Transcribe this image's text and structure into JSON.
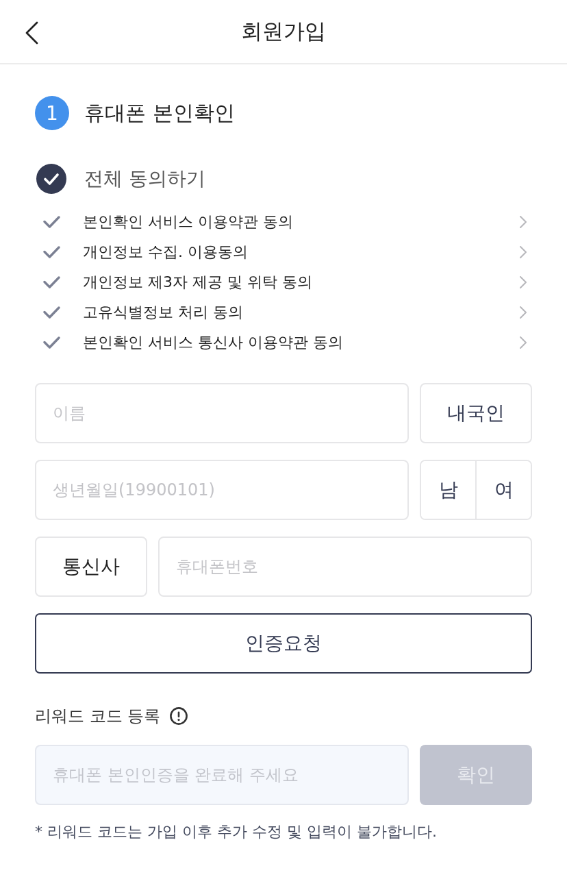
{
  "header": {
    "title": "회원가입"
  },
  "step": {
    "number": "1",
    "title": "휴대폰 본인확인"
  },
  "agree_all": {
    "label": "전체 동의하기",
    "checked": true
  },
  "terms": [
    {
      "label": "본인확인 서비스 이용약관 동의",
      "checked": true
    },
    {
      "label": "개인정보 수집. 이용동의",
      "checked": true
    },
    {
      "label": "개인정보 제3자 제공 및 위탁 동의",
      "checked": true
    },
    {
      "label": "고유식별정보 처리 동의",
      "checked": true
    },
    {
      "label": "본인확인 서비스 통신사 이용약관 동의",
      "checked": true
    }
  ],
  "form": {
    "name_field": {
      "placeholder": "이름"
    },
    "nationality_button": "내국인",
    "birth_field": {
      "placeholder": "생년월일(19900101)"
    },
    "gender": [
      {
        "label": "남",
        "selected": false
      },
      {
        "label": "여",
        "selected": false
      }
    ],
    "carrier_button": "통신사",
    "phone_field": {
      "placeholder": "휴대폰번호"
    },
    "request_button": "인증요청"
  },
  "reward": {
    "title": "리워드 코드 등록",
    "code_field": {
      "placeholder": "휴대폰 본인인증을 완료해 주세요",
      "disabled": true
    },
    "confirm_button": {
      "label": "확인",
      "disabled": true
    },
    "note": "* 리워드 코드는 가입 이후 추가 수정 및 입력이 불가합니다."
  }
}
